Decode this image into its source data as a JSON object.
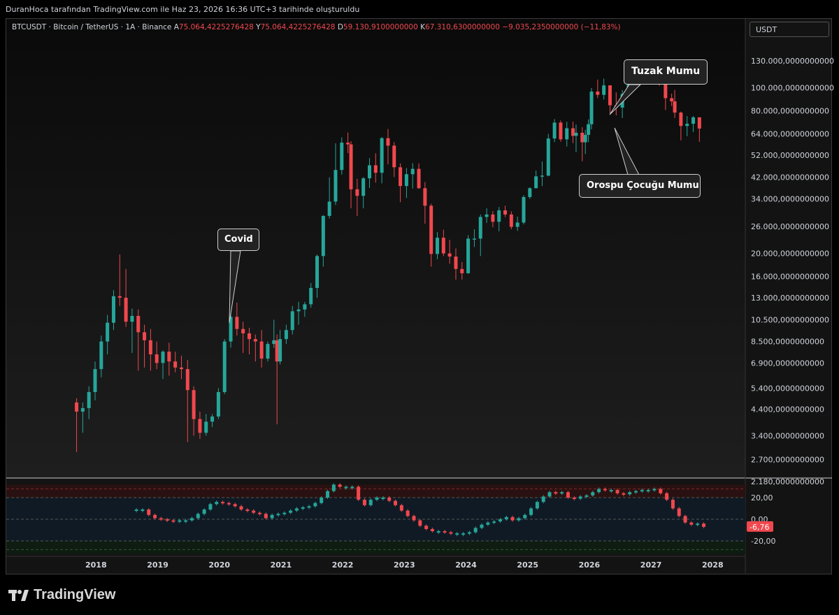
{
  "header": {
    "text": "DuranHoca tarafından TradingView.com ile Haz 23, 2026 16:36 UTC+3 tarihinde oluşturuldu"
  },
  "legend": {
    "symbol": "BTCUSDT · Bitcoin / TetherUS · 1A · Binance",
    "open_label": "A",
    "open_value": "75.064,4225276428",
    "high_label": "Y",
    "high_value": "75.064,4225276428",
    "low_label": "D",
    "low_value": "59.130,9100000000",
    "close_label": "K",
    "close_value": "67.310,6300000000",
    "change": "−9.035,2350000000 (−11,83%)"
  },
  "currency_badge": "USDT",
  "brand": "TradingView",
  "colors": {
    "up": "#26a69a",
    "down": "#f0484e",
    "background": "#131313"
  },
  "annotations": {
    "covid": "Covid",
    "tuzak": "Tuzak Mumu",
    "orospu": "Orospu Çocuğu Mumu"
  },
  "chart_data": [
    {
      "type": "candlestick",
      "scale": "log",
      "ylim": [
        2000,
        150000
      ],
      "y_ticks": [
        {
          "value": 130000,
          "label": "130.000,0000000000"
        },
        {
          "value": 100000,
          "label": "100.000,0000000000"
        },
        {
          "value": 80000,
          "label": "80.000,0000000000"
        },
        {
          "value": 64000,
          "label": "64.000,0000000000"
        },
        {
          "value": 52000,
          "label": "52.000,0000000000"
        },
        {
          "value": 42000,
          "label": "42.000,0000000000"
        },
        {
          "value": 34000,
          "label": "34.000,0000000000"
        },
        {
          "value": 26000,
          "label": "26.000,0000000000"
        },
        {
          "value": 20000,
          "label": "20.000,0000000000"
        },
        {
          "value": 16000,
          "label": "16.000,0000000000"
        },
        {
          "value": 13000,
          "label": "13.000,0000000000"
        },
        {
          "value": 10500,
          "label": "10.500,0000000000"
        },
        {
          "value": 8500,
          "label": "8.500,0000000000"
        },
        {
          "value": 6900,
          "label": "6.900,0000000000"
        },
        {
          "value": 5400,
          "label": "5.400,0000000000"
        },
        {
          "value": 4400,
          "label": "4.400,0000000000"
        },
        {
          "value": 3400,
          "label": "3.400,0000000000"
        },
        {
          "value": 2700,
          "label": "2.700,0000000000"
        },
        {
          "value": 2180,
          "label": "2.180,0000000000"
        }
      ],
      "x_labels": [
        {
          "value": 2018,
          "label": "2018"
        },
        {
          "value": 2019,
          "label": "2019"
        },
        {
          "value": 2020,
          "label": "2020"
        },
        {
          "value": 2021,
          "label": "2021"
        },
        {
          "value": 2022,
          "label": "2022"
        },
        {
          "value": 2023,
          "label": "2023"
        },
        {
          "value": 2024,
          "label": "2024"
        },
        {
          "value": 2025,
          "label": "2025"
        },
        {
          "value": 2026,
          "label": "2026"
        },
        {
          "value": 2027,
          "label": "2027"
        },
        {
          "value": 2028,
          "label": "2028"
        }
      ],
      "xlim": [
        2017.3,
        2028.6
      ],
      "candles": [
        [
          2017.7,
          4700,
          4900,
          2900,
          4300
        ],
        [
          2017.8,
          4300,
          4700,
          3500,
          4450
        ],
        [
          2017.9,
          4450,
          5500,
          4000,
          5200
        ],
        [
          2018.0,
          5200,
          7000,
          4800,
          6500
        ],
        [
          2018.1,
          6500,
          9000,
          6000,
          8500
        ],
        [
          2018.2,
          8500,
          11000,
          7500,
          10200
        ],
        [
          2018.3,
          10200,
          14000,
          9500,
          13200
        ],
        [
          2018.4,
          13200,
          19800,
          12000,
          13000
        ],
        [
          2018.5,
          13000,
          17200,
          9800,
          10300
        ],
        [
          2018.6,
          10300,
          11700,
          7600,
          10900
        ],
        [
          2018.7,
          10900,
          11600,
          6400,
          9300
        ],
        [
          2018.8,
          9300,
          10000,
          6600,
          8600
        ],
        [
          2018.9,
          8600,
          9600,
          6400,
          7500
        ],
        [
          2019.0,
          7500,
          8500,
          6500,
          6900
        ],
        [
          2019.1,
          6900,
          7800,
          5900,
          7700
        ],
        [
          2019.2,
          7700,
          8400,
          6100,
          7000
        ],
        [
          2019.3,
          7000,
          7700,
          6300,
          6600
        ],
        [
          2019.4,
          6600,
          7400,
          5900,
          6500
        ],
        [
          2019.5,
          6500,
          7100,
          3200,
          5300
        ],
        [
          2019.6,
          5300,
          5500,
          3400,
          4000
        ],
        [
          2019.7,
          4000,
          4300,
          3300,
          3500
        ],
        [
          2019.8,
          3500,
          4200,
          3400,
          3900
        ],
        [
          2019.9,
          3900,
          4200,
          3700,
          4100
        ],
        [
          2020.0,
          4100,
          5400,
          4000,
          5200
        ],
        [
          2020.1,
          5200,
          8700,
          5100,
          8500
        ],
        [
          2020.2,
          8500,
          13900,
          8000,
          10800
        ],
        [
          2020.3,
          10800,
          12400,
          9000,
          9600
        ],
        [
          2020.4,
          9600,
          10300,
          7600,
          9200
        ],
        [
          2020.5,
          9200,
          9700,
          7500,
          8700
        ],
        [
          2020.6,
          8700,
          9100,
          7000,
          8500
        ],
        [
          2020.7,
          8500,
          9500,
          6600,
          7200
        ],
        [
          2020.8,
          7200,
          8500,
          7000,
          8300
        ],
        [
          2020.9,
          8300,
          10500,
          8000,
          8600
        ],
        [
          2020.95,
          8600,
          9100,
          3800,
          7000
        ],
        [
          2021.0,
          7000,
          9500,
          6800,
          8700
        ],
        [
          2021.1,
          8700,
          10000,
          8300,
          9500
        ],
        [
          2021.2,
          9500,
          12000,
          9100,
          11400
        ],
        [
          2021.3,
          11400,
          12500,
          10000,
          11600
        ],
        [
          2021.4,
          11600,
          12500,
          10800,
          12200
        ],
        [
          2021.5,
          12200,
          15000,
          11800,
          14300
        ],
        [
          2021.6,
          14300,
          19800,
          13000,
          19500
        ],
        [
          2021.7,
          19500,
          29000,
          17600,
          28800
        ],
        [
          2021.8,
          28800,
          41900,
          28100,
          33100
        ],
        [
          2021.9,
          33100,
          58300,
          32000,
          45000
        ],
        [
          2022.0,
          45000,
          61800,
          43000,
          58700
        ],
        [
          2022.1,
          58700,
          64800,
          53000,
          57700
        ],
        [
          2022.15,
          57700,
          59500,
          31000,
          37300
        ],
        [
          2022.25,
          37300,
          41300,
          28800,
          35000
        ],
        [
          2022.35,
          35000,
          42000,
          31000,
          41500
        ],
        [
          2022.45,
          41500,
          50500,
          37800,
          47100
        ],
        [
          2022.55,
          47100,
          52900,
          39800,
          43800
        ],
        [
          2022.65,
          43800,
          62000,
          39500,
          61300
        ],
        [
          2022.75,
          61300,
          67000,
          47500,
          57000
        ],
        [
          2022.85,
          57000,
          59000,
          42000,
          46200
        ],
        [
          2022.95,
          46200,
          48000,
          32900,
          38500
        ],
        [
          2023.05,
          38500,
          45800,
          34300,
          43200
        ],
        [
          2023.15,
          43200,
          48100,
          37600,
          45500
        ],
        [
          2023.25,
          45500,
          48000,
          37400,
          37700
        ],
        [
          2023.35,
          37700,
          40000,
          26700,
          31800
        ],
        [
          2023.45,
          31800,
          32400,
          17600,
          19900
        ],
        [
          2023.55,
          19900,
          24600,
          18900,
          23300
        ],
        [
          2023.65,
          23300,
          25200,
          19500,
          20000
        ],
        [
          2023.75,
          20000,
          22800,
          18100,
          19400
        ],
        [
          2023.85,
          19400,
          21000,
          15500,
          17200
        ],
        [
          2023.95,
          17200,
          18400,
          15500,
          16500
        ],
        [
          2024.05,
          16500,
          23900,
          16400,
          23100
        ],
        [
          2024.15,
          23100,
          25300,
          21300,
          23100
        ],
        [
          2024.25,
          23100,
          29200,
          19500,
          28500
        ],
        [
          2024.35,
          28500,
          31000,
          26900,
          29200
        ],
        [
          2024.45,
          29200,
          30200,
          25800,
          27200
        ],
        [
          2024.55,
          27200,
          31400,
          24800,
          30400
        ],
        [
          2024.65,
          30400,
          31800,
          28500,
          29200
        ],
        [
          2024.75,
          29200,
          30100,
          25300,
          25900
        ],
        [
          2024.85,
          25900,
          28600,
          24900,
          27000
        ],
        [
          2024.95,
          27000,
          35200,
          26500,
          34600
        ],
        [
          2025.05,
          34600,
          38000,
          34000,
          37700
        ],
        [
          2025.15,
          37700,
          44700,
          37600,
          42300
        ],
        [
          2025.25,
          42300,
          48900,
          38500,
          42600
        ],
        [
          2025.35,
          42600,
          63900,
          42300,
          61100
        ],
        [
          2025.45,
          61100,
          73800,
          59000,
          71300
        ],
        [
          2025.55,
          71300,
          72800,
          59200,
          60600
        ],
        [
          2025.65,
          60600,
          71900,
          56500,
          67500
        ],
        [
          2025.75,
          67500,
          71900,
          58400,
          62700
        ],
        [
          2025.8,
          62700,
          70000,
          53500,
          64600
        ],
        [
          2025.9,
          64600,
          68200,
          49000,
          58900
        ],
        [
          2025.95,
          58900,
          66500,
          52500,
          63300
        ],
        [
          2026.0,
          63300,
          73600,
          58900,
          70200
        ],
        [
          2026.05,
          70200,
          99800,
          66800,
          96400
        ],
        [
          2026.15,
          96400,
          108300,
          90500,
          93400
        ],
        [
          2026.25,
          93400,
          109300,
          89200,
          102400
        ],
        [
          2026.35,
          102400,
          102500,
          78200,
          84400
        ],
        [
          2026.45,
          84400,
          95700,
          76500,
          82500
        ],
        [
          2026.55,
          82500,
          97900,
          74500,
          94200
        ],
        [
          2026.65,
          94200,
          111900,
          93300,
          104600
        ],
        [
          2026.75,
          104600,
          110600,
          98100,
          107100
        ],
        [
          2026.85,
          107100,
          123200,
          105200,
          115800
        ],
        [
          2026.95,
          115800,
          124500,
          107300,
          108200
        ],
        [
          2027.05,
          108200,
          117800,
          107300,
          114000
        ],
        [
          2027.15,
          114000,
          126100,
          102000,
          109600
        ],
        [
          2027.25,
          109600,
          110000,
          80600,
          90400
        ],
        [
          2027.35,
          90400,
          94500,
          83800,
          87700
        ],
        [
          2027.4,
          87700,
          97900,
          74600,
          78600
        ],
        [
          2027.5,
          78600,
          79400,
          60000,
          69000
        ],
        [
          2027.6,
          69000,
          76000,
          62500,
          70500
        ],
        [
          2027.7,
          70500,
          76000,
          65000,
          75064
        ],
        [
          2027.8,
          75064,
          75064,
          59130,
          67310
        ]
      ]
    },
    {
      "type": "histogram-oscillator",
      "ylim": [
        -32,
        32
      ],
      "y_ticks": [
        {
          "value": 20,
          "label": "20,00"
        },
        {
          "value": 0,
          "label": "0,00"
        },
        {
          "value": -20,
          "label": "-20,00"
        }
      ],
      "current_value": "-6,76",
      "points": [
        [
          2018.6,
          9
        ],
        [
          2018.7,
          9
        ],
        [
          2018.8,
          4
        ],
        [
          2018.9,
          1
        ],
        [
          2019.0,
          0
        ],
        [
          2019.1,
          -1
        ],
        [
          2019.2,
          -2
        ],
        [
          2019.3,
          -1
        ],
        [
          2019.4,
          -1
        ],
        [
          2019.5,
          1
        ],
        [
          2019.6,
          5
        ],
        [
          2019.7,
          9
        ],
        [
          2019.8,
          14
        ],
        [
          2019.9,
          16
        ],
        [
          2020.0,
          15
        ],
        [
          2020.1,
          14
        ],
        [
          2020.2,
          12
        ],
        [
          2020.3,
          9
        ],
        [
          2020.4,
          8
        ],
        [
          2020.5,
          6
        ],
        [
          2020.6,
          5
        ],
        [
          2020.7,
          1
        ],
        [
          2020.8,
          4
        ],
        [
          2020.9,
          5
        ],
        [
          2021.0,
          6
        ],
        [
          2021.1,
          8
        ],
        [
          2021.2,
          10
        ],
        [
          2021.3,
          11
        ],
        [
          2021.4,
          12
        ],
        [
          2021.5,
          15
        ],
        [
          2021.6,
          20
        ],
        [
          2021.7,
          26
        ],
        [
          2021.8,
          32
        ],
        [
          2021.9,
          30
        ],
        [
          2022.0,
          30
        ],
        [
          2022.1,
          30
        ],
        [
          2022.2,
          18
        ],
        [
          2022.3,
          13
        ],
        [
          2022.4,
          18
        ],
        [
          2022.5,
          20
        ],
        [
          2022.6,
          20
        ],
        [
          2022.7,
          17
        ],
        [
          2022.8,
          13
        ],
        [
          2022.9,
          8
        ],
        [
          2023.0,
          3
        ],
        [
          2023.1,
          -1
        ],
        [
          2023.2,
          -6
        ],
        [
          2023.3,
          -9
        ],
        [
          2023.4,
          -11
        ],
        [
          2023.5,
          -11
        ],
        [
          2023.6,
          -12
        ],
        [
          2023.7,
          -13
        ],
        [
          2023.8,
          -13
        ],
        [
          2023.9,
          -13
        ],
        [
          2024.0,
          -12
        ],
        [
          2024.1,
          -8
        ],
        [
          2024.2,
          -5
        ],
        [
          2024.3,
          -3
        ],
        [
          2024.4,
          -2
        ],
        [
          2024.5,
          0
        ],
        [
          2024.6,
          2
        ],
        [
          2024.7,
          -1
        ],
        [
          2024.8,
          1
        ],
        [
          2024.9,
          4
        ],
        [
          2025.0,
          10
        ],
        [
          2025.1,
          16
        ],
        [
          2025.2,
          21
        ],
        [
          2025.3,
          25
        ],
        [
          2025.4,
          24
        ],
        [
          2025.5,
          25
        ],
        [
          2025.6,
          20
        ],
        [
          2025.7,
          19
        ],
        [
          2025.8,
          21
        ],
        [
          2025.9,
          22
        ],
        [
          2026.0,
          25
        ],
        [
          2026.1,
          28
        ],
        [
          2026.2,
          27
        ],
        [
          2026.3,
          27
        ],
        [
          2026.4,
          24
        ],
        [
          2026.5,
          23
        ],
        [
          2026.6,
          25
        ],
        [
          2026.7,
          26
        ],
        [
          2026.8,
          27
        ],
        [
          2026.9,
          27
        ],
        [
          2027.0,
          28
        ],
        [
          2027.1,
          24
        ],
        [
          2027.2,
          18
        ],
        [
          2027.3,
          10
        ],
        [
          2027.4,
          3
        ],
        [
          2027.5,
          -3
        ],
        [
          2027.6,
          -5
        ],
        [
          2027.7,
          -4
        ],
        [
          2027.8,
          -7
        ]
      ]
    }
  ]
}
